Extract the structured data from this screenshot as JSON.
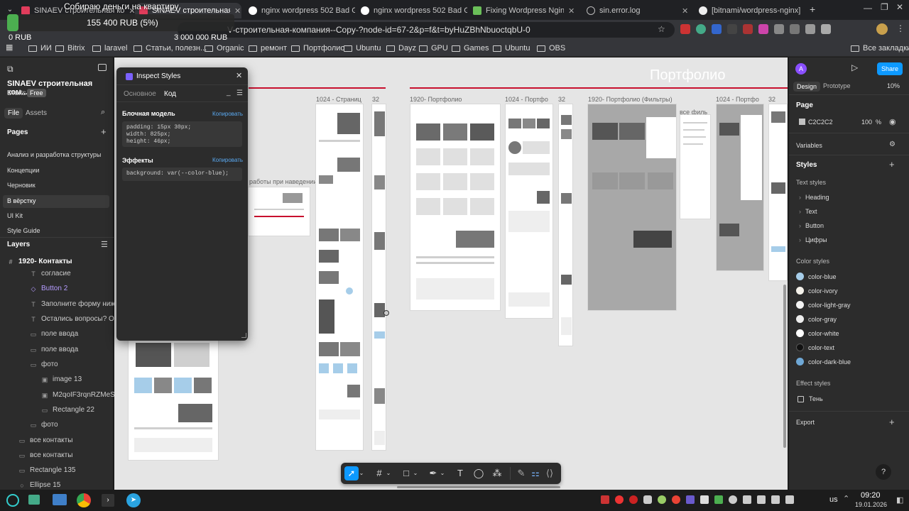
{
  "browser": {
    "tabs": [
      {
        "label": "SINAEV строительная ко",
        "active": false
      },
      {
        "label": "SINAEV строительная комп",
        "active": true
      },
      {
        "label": "nginx wordpress 502 Bad G",
        "active": false
      },
      {
        "label": "nginx wordpress 502 Bad G",
        "active": false
      },
      {
        "label": "Fixing Wordpress Nginx \"5",
        "active": false
      },
      {
        "label": "sin.error.log",
        "active": false
      },
      {
        "label": "[bitnami/wordpress-nginx]",
        "active": false
      }
    ],
    "address": "V-строительная-компания--Copy-?node-id=67-2&p=f&t=byHuZBhNbuoctqbU-0",
    "bookmarks": [
      "ИИ",
      "Bitrix",
      "laravel",
      "Статьи, полезн...",
      "Organic",
      "ремонт",
      "Портфолио",
      "Ubuntu",
      "Dayz",
      "GPU",
      "Games",
      "Ubuntu",
      "OBS"
    ],
    "all_bookmarks": "Все закладки"
  },
  "donation": {
    "title": "Собираю деньги на квартиру",
    "collected": "155 400 RUB (5%)",
    "start": "0 RUB",
    "goal": "3 000 000 RUB",
    "progress": 0.05
  },
  "left_panel": {
    "project": "SINAEV строительная ком...",
    "drafts": "Drafts",
    "plan": "Free",
    "tabs": [
      "File",
      "Assets"
    ],
    "pages_title": "Pages",
    "pages": [
      "Анализ и разработка структуры",
      "Концепции",
      "Черновик",
      "В вёрстку",
      "UI Kit",
      "Style Guide"
    ],
    "layers_title": "Layers",
    "layers_root": "1920- Контакты",
    "layers": [
      {
        "label": "согласие",
        "icon": "text"
      },
      {
        "label": "Button 2",
        "icon": "component"
      },
      {
        "label": "Заполните форму ниже и мы",
        "icon": "text"
      },
      {
        "label": "Остались вопросы? Оставьте",
        "icon": "text"
      },
      {
        "label": "поле ввода",
        "icon": "rect"
      },
      {
        "label": "поле ввода",
        "icon": "rect"
      },
      {
        "label": "фото",
        "icon": "rect"
      },
      {
        "label": "image 13",
        "icon": "image"
      },
      {
        "label": "M2qoIF3rqnRZMeS91KU",
        "icon": "image"
      },
      {
        "label": "Rectangle 22",
        "icon": "rect"
      },
      {
        "label": "фото",
        "icon": "rect"
      },
      {
        "label": "все контакты",
        "icon": "rect"
      },
      {
        "label": "все контакты",
        "icon": "rect"
      },
      {
        "label": "Rectangle 135",
        "icon": "rect"
      },
      {
        "label": "Ellipse 15",
        "icon": "ellipse"
      }
    ]
  },
  "inspect": {
    "title": "Inspect Styles",
    "tabs": [
      "Основное",
      "Код"
    ],
    "box_title": "Блочная модель",
    "copy": "Копировать",
    "box_code": [
      "padding: 15px 30px;",
      "width: 825px;",
      "height: 46px;"
    ],
    "effects_title": "Эффекты",
    "effects_code": "background: var(--color-blue);"
  },
  "canvas": {
    "heading": "Портфолио",
    "hover_label": "работы при наведении",
    "all_filters_label": "все филь",
    "frames": [
      "1024 - Страниц",
      "32",
      "1920- Портфолио",
      "1024 - Портфо",
      "32",
      "1920- Портфолио (Фильтры)",
      "1024 - Портфо",
      "32"
    ]
  },
  "right_panel": {
    "avatar": "A",
    "share": "Share",
    "tabs": [
      "Design",
      "Prototype"
    ],
    "zoom": "10%",
    "page_title": "Page",
    "page_color": "C2C2C2",
    "page_opacity": "100",
    "percent": "%",
    "variables": "Variables",
    "styles": "Styles",
    "text_styles": "Text styles",
    "text_style_items": [
      "Heading",
      "Text",
      "Button",
      "Цифры"
    ],
    "color_styles": "Color styles",
    "colors": [
      {
        "name": "color-blue",
        "hex": "#a6cde9"
      },
      {
        "name": "color-ivory",
        "hex": "#f4f1ea"
      },
      {
        "name": "color-light-gray",
        "hex": "#f2f2f2"
      },
      {
        "name": "color-gray",
        "hex": "#ededed"
      },
      {
        "name": "color-white",
        "hex": "#ffffff"
      },
      {
        "name": "color-text",
        "hex": "#111111"
      },
      {
        "name": "color-dark-blue",
        "hex": "#6fa8d6"
      }
    ],
    "effect_styles": "Effect styles",
    "effect_items": [
      "Тень"
    ],
    "export": "Export"
  },
  "taskbar": {
    "lang": "us",
    "time": "09:20",
    "date": "19.01.2026"
  }
}
